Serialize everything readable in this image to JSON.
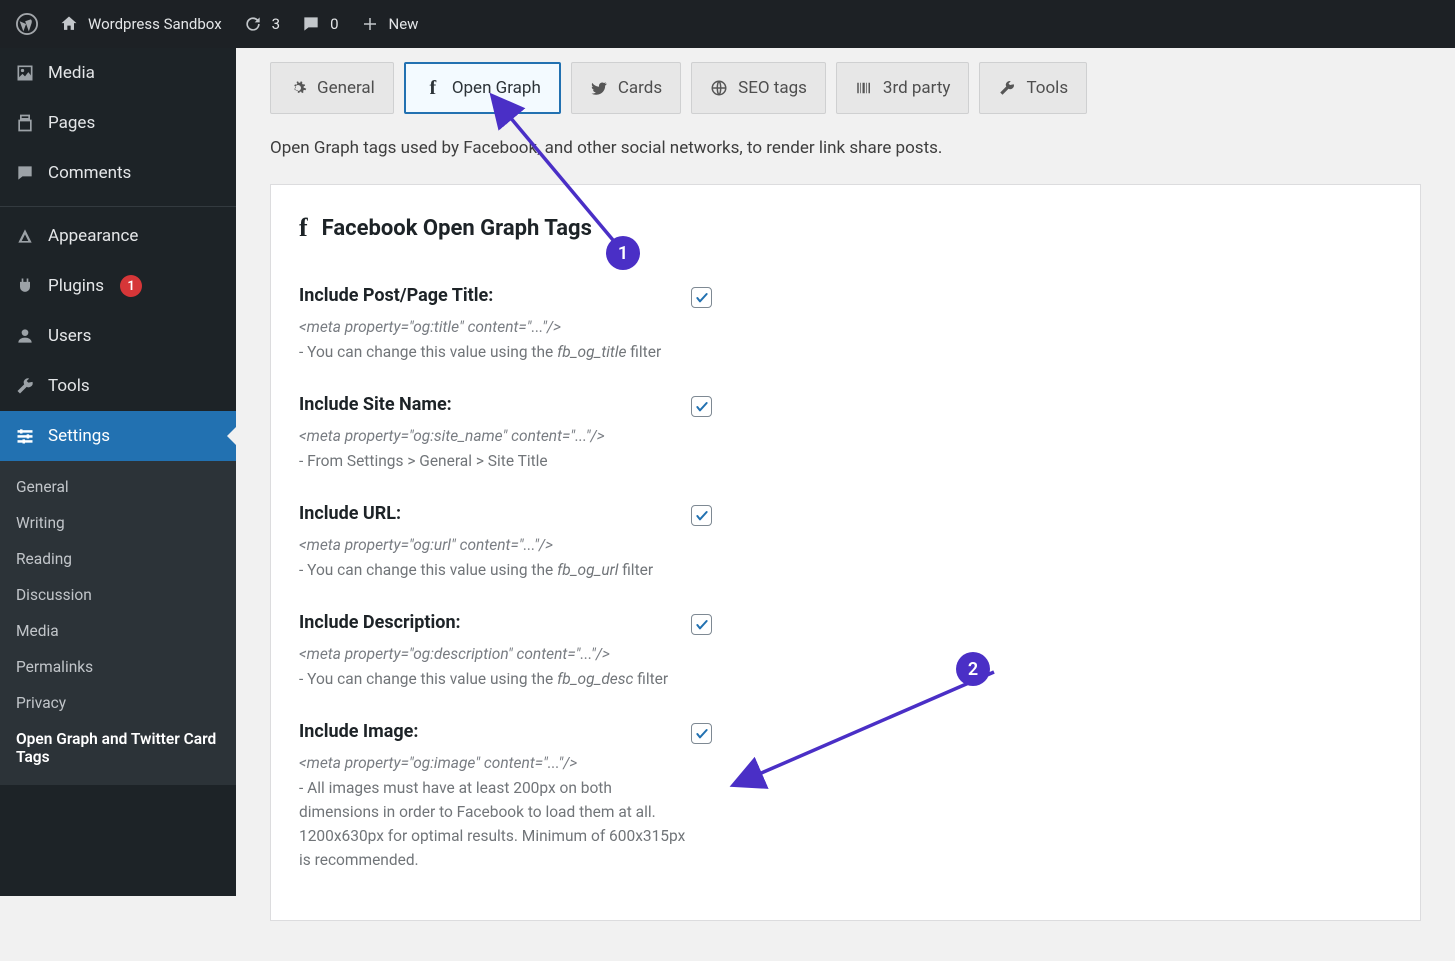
{
  "topbar": {
    "site_title": "Wordpress Sandbox",
    "updates_count": "3",
    "comments_count": "0",
    "new_label": "New"
  },
  "sidebar": {
    "items": [
      {
        "label": "Media",
        "icon": "media"
      },
      {
        "label": "Pages",
        "icon": "pages"
      },
      {
        "label": "Comments",
        "icon": "comments"
      },
      {
        "label": "Appearance",
        "icon": "appearance"
      },
      {
        "label": "Plugins",
        "icon": "plugins",
        "badge": "1"
      },
      {
        "label": "Users",
        "icon": "users"
      },
      {
        "label": "Tools",
        "icon": "tools"
      },
      {
        "label": "Settings",
        "icon": "settings"
      }
    ],
    "sub_items": [
      {
        "label": "General"
      },
      {
        "label": "Writing"
      },
      {
        "label": "Reading"
      },
      {
        "label": "Discussion"
      },
      {
        "label": "Media"
      },
      {
        "label": "Permalinks"
      },
      {
        "label": "Privacy"
      },
      {
        "label": "Open Graph and Twitter Card Tags",
        "active": true
      }
    ]
  },
  "tabs": [
    {
      "label": "General",
      "icon": "gear"
    },
    {
      "label": "Open Graph",
      "icon": "facebook",
      "active": true
    },
    {
      "label": "Cards",
      "icon": "twitter"
    },
    {
      "label": "SEO tags",
      "icon": "globe"
    },
    {
      "label": "3rd party",
      "icon": "barcode"
    },
    {
      "label": "Tools",
      "icon": "wrench"
    }
  ],
  "intro_text": "Open Graph tags used by Facebook, and other social networks, to render link share posts.",
  "panel": {
    "heading": "Facebook Open Graph Tags",
    "options": [
      {
        "title": "Include Post/Page Title:",
        "meta": "<meta property=\"og:title\" content=\"...\"/>",
        "hint_pre": "- You can change this value using the ",
        "hint_em": "fb_og_title",
        "hint_post": " filter",
        "checked": true
      },
      {
        "title": "Include Site Name:",
        "meta": "<meta property=\"og:site_name\" content=\"...\"/>",
        "hint_pre": "- From Settings > General > Site Title",
        "hint_em": "",
        "hint_post": "",
        "checked": true
      },
      {
        "title": "Include URL:",
        "meta": "<meta property=\"og:url\" content=\"...\"/>",
        "hint_pre": "- You can change this value using the ",
        "hint_em": "fb_og_url",
        "hint_post": " filter",
        "checked": true
      },
      {
        "title": "Include Description:",
        "meta": "<meta property=\"og:description\" content=\"...\"/>",
        "hint_pre": "- You can change this value using the ",
        "hint_em": "fb_og_desc",
        "hint_post": " filter",
        "checked": true
      },
      {
        "title": "Include Image:",
        "meta": "<meta property=\"og:image\" content=\"...\"/>",
        "hint_pre": "- All images must have at least 200px on both dimensions in order to Facebook to load them at all. 1200x630px for optimal results. Minimum of 600x315px is recommended.",
        "hint_em": "",
        "hint_post": "",
        "checked": true
      }
    ]
  },
  "annotations": {
    "step1": "1",
    "step2": "2"
  }
}
